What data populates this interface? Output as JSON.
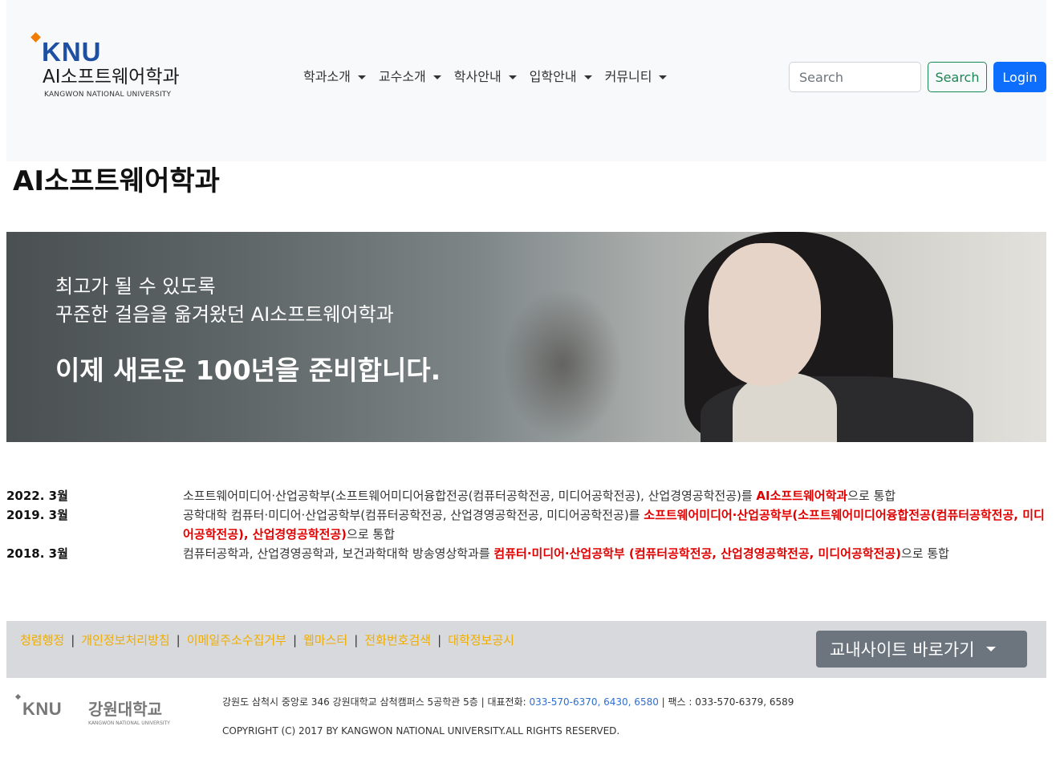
{
  "header": {
    "logo_mark": "KNU",
    "dept_name": "AI소프트웨어학과",
    "univ_name": "KANGWON NATIONAL UNIVERSITY",
    "nav": [
      {
        "label": "학과소개"
      },
      {
        "label": "교수소개"
      },
      {
        "label": "학사안내"
      },
      {
        "label": "입학안내"
      },
      {
        "label": "커뮤니티"
      }
    ],
    "search_placeholder": "Search",
    "search_button": "Search",
    "login_button": "Login"
  },
  "page_title": "AI소프트웨어학과",
  "banner": {
    "line1": "최고가 될 수 있도록",
    "line2": "꾸준한 걸음을 옮겨왔던 AI소프트웨어학과",
    "line3": "이제 새로운 100년을 준비합니다."
  },
  "history": [
    {
      "date": "2022. 3월",
      "pre": "소프트웨어미디어·산업공학부(소프트웨어미디어융합전공(컴퓨터공학전공, 미디어공학전공), 산업경영공학전공)를 ",
      "highlight": "AI소프트웨어학과",
      "post": "으로 통합"
    },
    {
      "date": "2019. 3월",
      "pre": "공학대학 컴퓨터·미디어·산업공학부(컴퓨터공학전공, 산업경영공학전공, 미디어공학전공)를 ",
      "highlight": "소프트웨어미디어·산업공학부(소프트웨어미디어융합전공(컴퓨터공학전공, 미디어공학전공), 산업경영공학전공)",
      "post": "으로 통합"
    },
    {
      "date": "2018. 3월",
      "pre": "컴퓨터공학과, 산업경영공학과, 보건과학대학 방송영상학과를 ",
      "highlight": "컴퓨터·미디어·산업공학부 (컴퓨터공학전공, 산업경영공학전공, 미디어공학전공)",
      "post": "으로 통합"
    }
  ],
  "footer": {
    "links": [
      {
        "label": "청렴행정"
      },
      {
        "label": "개인정보처리방침"
      },
      {
        "label": "이메일주소수집거부"
      },
      {
        "label": "웹마스터"
      },
      {
        "label": "전화번호검색"
      },
      {
        "label": "대학정보공시"
      }
    ],
    "separator": "|",
    "sites_button": "교내사이트 바로가기",
    "logo_mark": "KNU",
    "logo_name": "강원대학교",
    "logo_univ": "KANGWON NATIONAL UNIVERSITY",
    "address": "강원도 삼척시 중앙로 346 강원대학교 삼척캠퍼스 5공학관 5층 | 대표전화: ",
    "tel": "033-570-6370, 6430, 6580",
    "fax": " | 팩스 : 033-570-6379, 6589",
    "copyright": "COPYRIGHT (C) 2017 BY KANGWON NATIONAL UNIVERSITY.ALL RIGHTS RESERVED."
  },
  "colors": {
    "navbar_bg": "#f8f9fa",
    "primary": "#0d6efd",
    "success": "#198754",
    "highlight": "#e00000",
    "footer_link": "#f0ad00",
    "footer_bg": "#d7d9dc",
    "secondary": "#6c757d"
  },
  "icons": {
    "nav_caret": "caret-down-icon",
    "sites_caret": "caret-down-icon"
  }
}
